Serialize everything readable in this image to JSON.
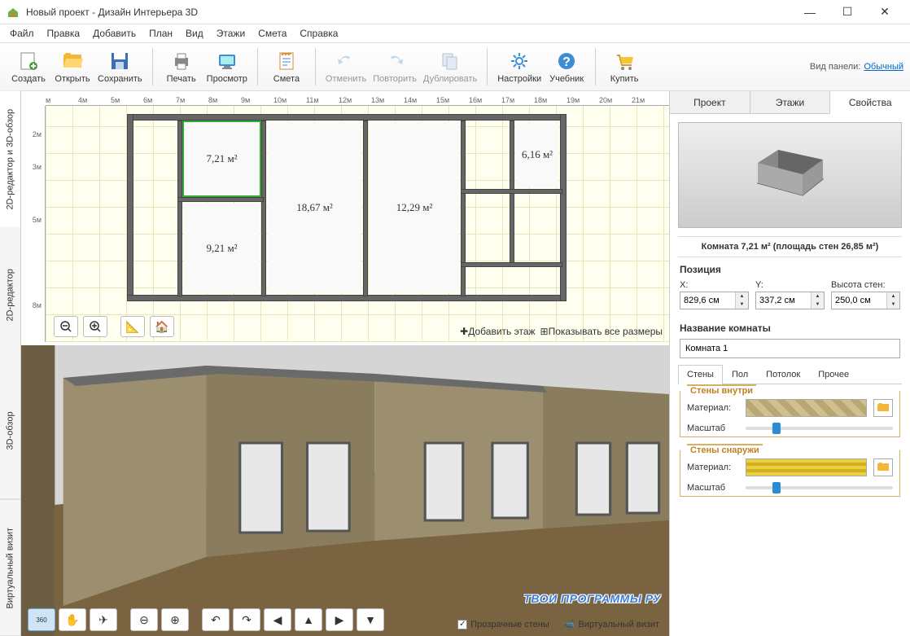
{
  "title": "Новый проект - Дизайн Интерьера 3D",
  "window_controls": {
    "min": "—",
    "max": "☐",
    "close": "✕"
  },
  "menu": [
    "Файл",
    "Правка",
    "Добавить",
    "План",
    "Вид",
    "Этажи",
    "Смета",
    "Справка"
  ],
  "toolbar": [
    {
      "id": "create",
      "label": "Создать"
    },
    {
      "id": "open",
      "label": "Открыть"
    },
    {
      "id": "save",
      "label": "Сохранить"
    },
    {
      "id": "sep"
    },
    {
      "id": "print",
      "label": "Печать"
    },
    {
      "id": "preview",
      "label": "Просмотр"
    },
    {
      "id": "sep"
    },
    {
      "id": "estimate",
      "label": "Смета"
    },
    {
      "id": "sep"
    },
    {
      "id": "undo",
      "label": "Отменить",
      "disabled": true
    },
    {
      "id": "redo",
      "label": "Повторить",
      "disabled": true
    },
    {
      "id": "dup",
      "label": "Дублировать",
      "disabled": true
    },
    {
      "id": "sep"
    },
    {
      "id": "settings",
      "label": "Настройки"
    },
    {
      "id": "tutorial",
      "label": "Учебник"
    },
    {
      "id": "sep"
    },
    {
      "id": "buy",
      "label": "Купить"
    }
  ],
  "panel_mode": {
    "label": "Вид панели:",
    "value": "Обычный"
  },
  "side_tabs": [
    "2D-редактор и 3D-обзор",
    "2D-редактор",
    "3D-обзор",
    "Виртуальный визит"
  ],
  "ruler_h": [
    "м",
    "4м",
    "5м",
    "6м",
    "7м",
    "8м",
    "9м",
    "10м",
    "11м",
    "12м",
    "13м",
    "14м",
    "15м",
    "16м",
    "17м",
    "18м",
    "19м",
    "20м",
    "21м"
  ],
  "ruler_v": [
    "2м",
    "3м",
    "5м",
    "8м"
  ],
  "rooms": {
    "r1": "7,21 м²",
    "r2": "18,67 м²",
    "r3": "12,29 м²",
    "r4": "6,16 м²",
    "r5": "9,21 м²"
  },
  "plan_actions": {
    "add_floor": "Добавить этаж",
    "show_dims": "Показывать все размеры"
  },
  "view3d_opts": {
    "transparent": "Прозрачные стены",
    "virtual": "Виртуальный визит"
  },
  "prop_tabs": [
    "Проект",
    "Этажи",
    "Свойства"
  ],
  "room_info": "Комната 7,21 м²  (площадь стен 26,85 м²)",
  "position": {
    "title": "Позиция",
    "x_label": "X:",
    "x": "829,6 см",
    "y_label": "Y:",
    "y": "337,2 см",
    "h_label": "Высота стен:",
    "h": "250,0 см"
  },
  "room_name": {
    "title": "Название комнаты",
    "value": "Комната 1"
  },
  "sub_tabs": [
    "Стены",
    "Пол",
    "Потолок",
    "Прочее"
  ],
  "walls_inner": {
    "title": "Стены внутри",
    "material": "Материал:",
    "scale": "Масштаб"
  },
  "walls_outer": {
    "title": "Стены снаружи",
    "material": "Материал:",
    "scale": "Масштаб"
  },
  "watermark": "ТВОИ ПРОГРАММЫ РУ"
}
